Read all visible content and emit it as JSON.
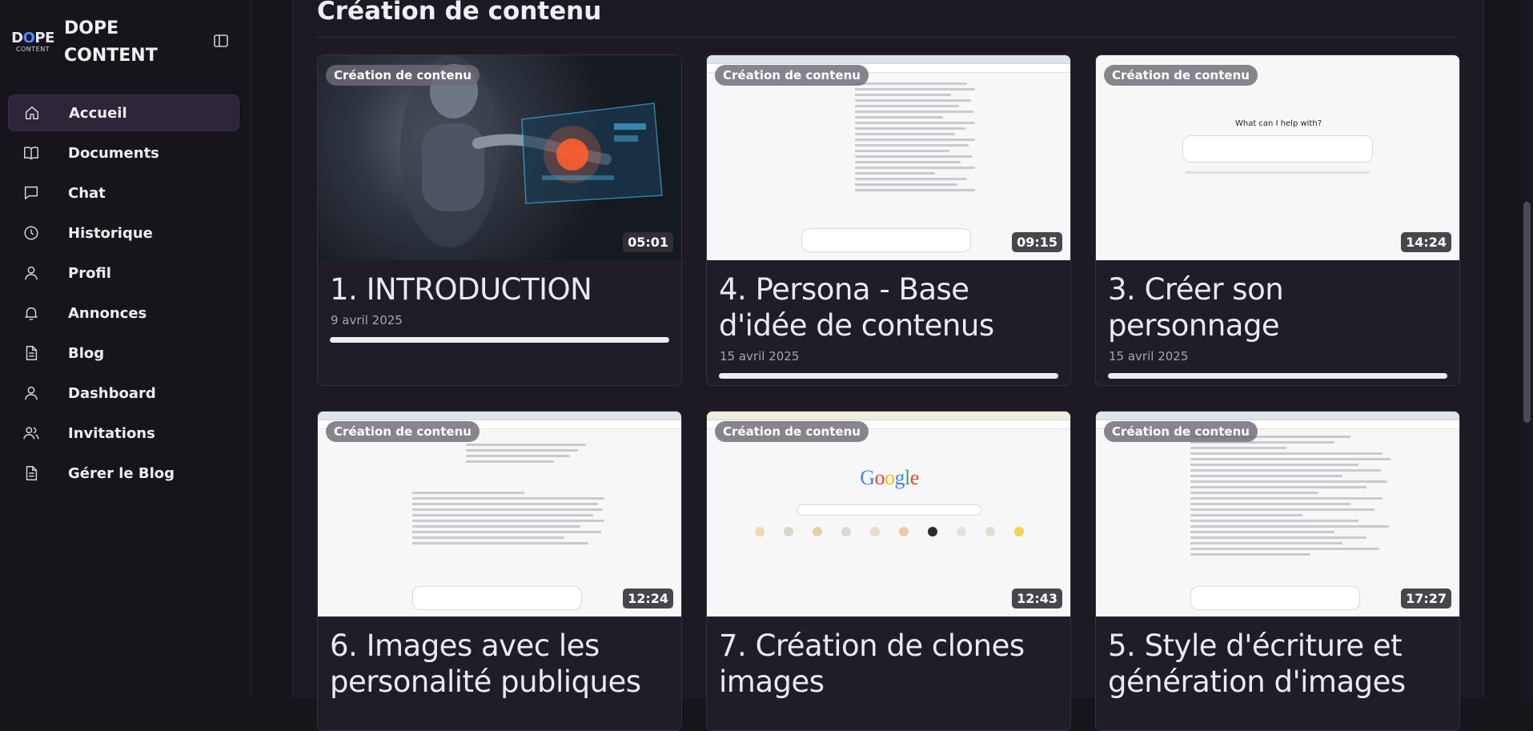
{
  "brand": {
    "logo_mark": "DOPE",
    "logo_sub": "CONTENT",
    "name": "DOPE CONTENT"
  },
  "sidebar": {
    "items": [
      {
        "label": "Accueil",
        "icon": "home-icon",
        "active": true
      },
      {
        "label": "Documents",
        "icon": "book-icon"
      },
      {
        "label": "Chat",
        "icon": "chat-icon"
      },
      {
        "label": "Historique",
        "icon": "clock-icon"
      },
      {
        "label": "Profil",
        "icon": "user-icon"
      },
      {
        "label": "Annonces",
        "icon": "bell-icon"
      },
      {
        "label": "Blog",
        "icon": "document-icon"
      },
      {
        "label": "Dashboard",
        "icon": "user-icon"
      },
      {
        "label": "Invitations",
        "icon": "users-icon"
      },
      {
        "label": "Gérer le Blog",
        "icon": "document-icon"
      }
    ]
  },
  "section": {
    "title": "Création de contenu"
  },
  "cards": [
    {
      "badge": "Création de contenu",
      "duration": "05:01",
      "title": "1. INTRODUCTION",
      "date": "9 avril 2025",
      "progress": 1.0
    },
    {
      "badge": "Création de contenu",
      "duration": "09:15",
      "title": "4. Persona - Base d'idée de contenus",
      "date": "15 avril 2025",
      "progress": 1.0
    },
    {
      "badge": "Création de contenu",
      "duration": "14:24",
      "title": "3. Créer son personnage",
      "date": "15 avril 2025",
      "progress": 1.0
    },
    {
      "badge": "Création de contenu",
      "duration": "12:24",
      "title": "6. Images avec les personalité publiques",
      "date": "",
      "progress": null
    },
    {
      "badge": "Création de contenu",
      "duration": "12:43",
      "title": "7. Création de clones images",
      "date": "",
      "progress": null
    },
    {
      "badge": "Création de contenu",
      "duration": "17:27",
      "title": "5. Style d'écriture et génération d'images",
      "date": "",
      "progress": null
    }
  ],
  "thumbs": {
    "chatgpt_prompt": "What can I help with?",
    "google_logo": "Google"
  },
  "colors": {
    "background": "#17141c",
    "panel": "#1d1a24",
    "active_nav": "#2d2638",
    "accent": "#4b8cff"
  }
}
